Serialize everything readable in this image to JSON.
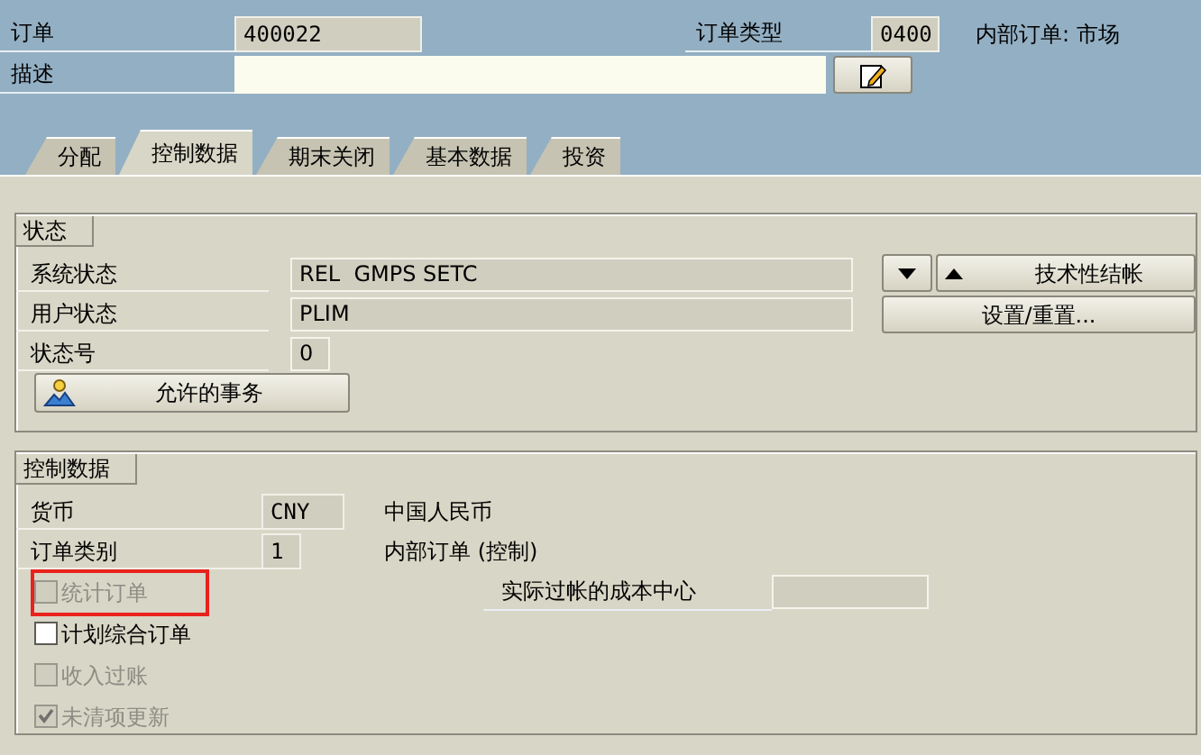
{
  "header": {
    "order_label": "订单",
    "order_value": "400022",
    "type_label": "订单类型",
    "type_value": "0400",
    "type_text": "内部订单: 市场",
    "description_label": "描述"
  },
  "tabs": [
    {
      "label": "分配",
      "selected": false
    },
    {
      "label": "控制数据",
      "selected": true
    },
    {
      "label": "期末关闭",
      "selected": false
    },
    {
      "label": "基本数据",
      "selected": false
    },
    {
      "label": "投资",
      "selected": false
    }
  ],
  "status_group": {
    "title": "状态",
    "rows": [
      {
        "label": "系统状态",
        "value": "REL  GMPS SETC"
      },
      {
        "label": "用户状态",
        "value": "PLIM"
      },
      {
        "label": "状态号",
        "value": "0"
      }
    ],
    "tech_close_button": "技术性结帐",
    "set_reset_button": "设置/重置...",
    "allowed_button": "允许的事务"
  },
  "control_group": {
    "title": "控制数据",
    "fields": [
      {
        "label": "货币",
        "value": "CNY",
        "text": "中国人民币"
      },
      {
        "label": "订单类别",
        "value": "1",
        "text": "内部订单 (控制)"
      }
    ],
    "checkboxes": [
      {
        "label": "统计订单",
        "checked": false,
        "disabled": true,
        "highlighted": true
      },
      {
        "label": "计划综合订单",
        "checked": false,
        "disabled": false,
        "highlighted": false
      },
      {
        "label": "收入过账",
        "checked": false,
        "disabled": true,
        "highlighted": false
      },
      {
        "label": "未清项更新",
        "checked": true,
        "disabled": true,
        "highlighted": false
      }
    ],
    "cost_center_label": "实际过帐的成本中心"
  }
}
